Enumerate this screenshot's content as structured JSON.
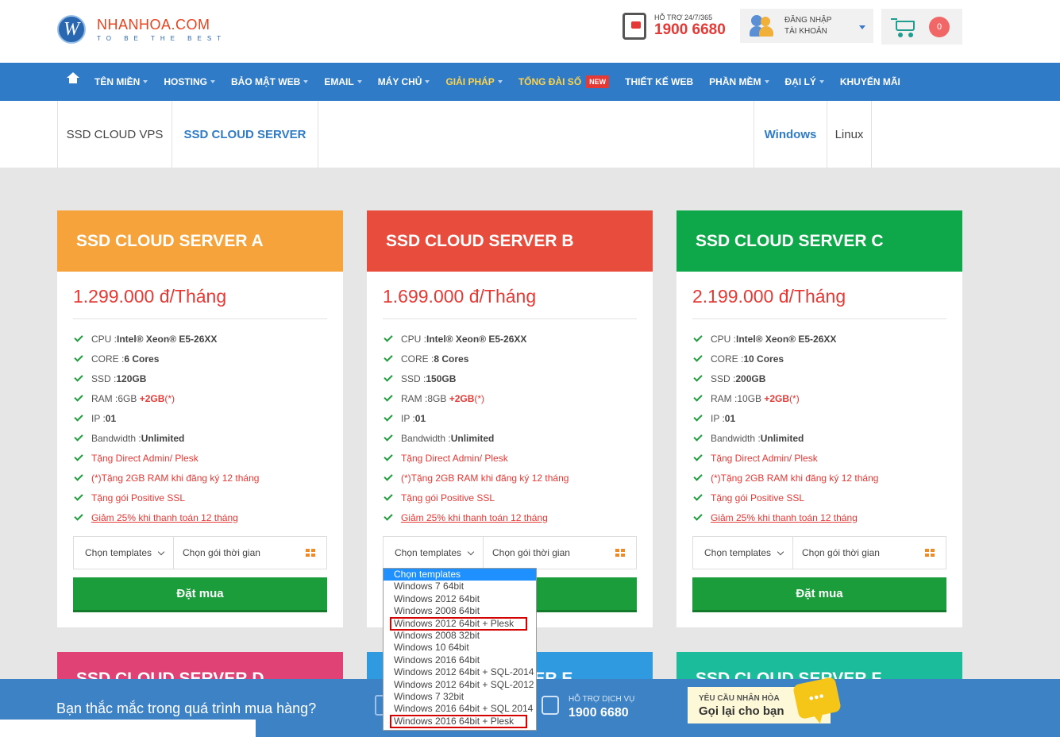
{
  "header": {
    "logo_letter": "W",
    "logo_name": "NHANHOA.COM",
    "logo_tagline": "TO BE THE BEST",
    "hotline_label": "HỖ TRỢ 24/7/365",
    "hotline_number": "1900 6680",
    "login_line1": "ĐĂNG NHẬP",
    "login_line2": "TÀI KHOẢN",
    "cart_count": "0"
  },
  "nav": {
    "items": [
      {
        "label": "TÊN MIỀN",
        "caret": true
      },
      {
        "label": "HOSTING",
        "caret": true
      },
      {
        "label": "BẢO MẬT WEB",
        "caret": true
      },
      {
        "label": "EMAIL",
        "caret": true
      },
      {
        "label": "MÁY CHỦ",
        "caret": true
      },
      {
        "label": "GIẢI PHÁP",
        "caret": true,
        "highlight": true
      },
      {
        "label": "TỔNG ĐÀI SỐ",
        "caret": false,
        "highlight": true,
        "badge": "NEW"
      },
      {
        "label": "THIẾT KẾ WEB",
        "caret": false
      },
      {
        "label": "PHẦN MỀM",
        "caret": true
      },
      {
        "label": "ĐẠI LÝ",
        "caret": true
      },
      {
        "label": "KHUYẾN MÃI",
        "caret": false
      }
    ]
  },
  "tabs": {
    "product": [
      "SSD CLOUD VPS",
      "SSD CLOUD SERVER"
    ],
    "product_active": "SSD CLOUD SERVER",
    "os": [
      "Windows",
      "Linux"
    ],
    "os_active": "Windows"
  },
  "colors": {
    "card_a": "#f5a33a",
    "card_b": "#e84c3d",
    "card_c": "#0ea84a",
    "card_d": "#e04275",
    "card_e": "#2f9ae0",
    "card_f": "#1abc9c",
    "nav_bg": "#2f7bc7",
    "buy_button": "#1a9d3a"
  },
  "plans": [
    {
      "name": "SSD CLOUD SERVER A",
      "price": "1.299.000 đ/Tháng",
      "cpu": "Intel® Xeon® E5-26XX",
      "core": "6 Cores",
      "ssd": "120GB",
      "ram": "6GB",
      "ram_bonus": "+2GB",
      "ram_note": "(*)",
      "ip": "01",
      "bandwidth": "Unlimited"
    },
    {
      "name": "SSD CLOUD SERVER B",
      "price": "1.699.000 đ/Tháng",
      "cpu": "Intel® Xeon® E5-26XX",
      "core": "8 Cores",
      "ssd": "150GB",
      "ram": "8GB",
      "ram_bonus": "+2GB",
      "ram_note": "(*)",
      "ip": "01",
      "bandwidth": "Unlimited"
    },
    {
      "name": "SSD CLOUD SERVER C",
      "price": "2.199.000 đ/Tháng",
      "cpu": "Intel® Xeon® E5-26XX",
      "core": "10 Cores",
      "ssd": "200GB",
      "ram": "10GB",
      "ram_bonus": "+2GB",
      "ram_note": "(*)",
      "ip": "01",
      "bandwidth": "Unlimited"
    }
  ],
  "feature_labels": {
    "cpu": "CPU : ",
    "core": "CORE : ",
    "ssd": "SSD : ",
    "ram": "RAM : ",
    "ip": "IP : ",
    "bandwidth": "Bandwidth : "
  },
  "promos": {
    "p1": "Tặng Direct Admin/ Plesk",
    "p2": "(*)Tặng 2GB RAM khi đăng ký 12 tháng",
    "p3": "Tặng gói Positive SSL",
    "p4": "Giảm 25% khi thanh toán 12 tháng"
  },
  "selects": {
    "template_placeholder": "Chọn templates",
    "period_placeholder": "Chọn gói thời gian"
  },
  "buy_label": "Đặt mua",
  "lower_cards": [
    "SSD CLOUD SERVER D",
    "SSD CLOUD SERVER E",
    "SSD CLOUD SERVER F"
  ],
  "template_dropdown": {
    "options": [
      "Chọn templates",
      "Windows 7 64bit",
      "Windows 2012 64bit",
      "Windows 2008 64bit",
      "Windows 2012 64bit + Plesk",
      "Windows 2008 32bit",
      "Windows 10 64bit",
      "Windows 2016 64bit",
      "Windows 2012 64bit + SQL-2014",
      "Windows 2012 64bit + SQL-2012",
      "Windows 7 32bit",
      "Windows 2016 64bit + SQL 2014",
      "Windows 2016 64bit + Plesk"
    ],
    "selected": "Chọn templates",
    "highlighted": [
      "Windows 2012 64bit + Plesk",
      "Windows 2016 64bit + Plesk"
    ]
  },
  "bottom_bar": {
    "question": "Bạn thắc mắc trong quá trình mua hàng?",
    "support_label": "HỖ TRỢ DỊCH VỤ",
    "support_number": "1900 6680",
    "callback_label": "YÊU CẦU NHÂN HÒA",
    "callback_action": "Gọi lại cho bạn",
    "chat_glyph": "•••"
  }
}
